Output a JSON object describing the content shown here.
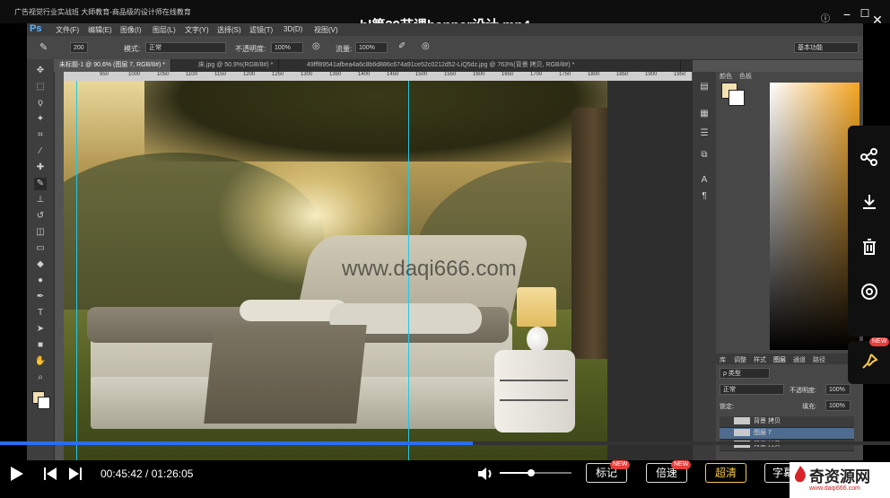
{
  "window": {
    "title": "广告视觉行业实战班 大師教育-商品级的设计师在线教育",
    "video_title": "bl第39节课banner设计.mp4",
    "controls": [
      "ⓘ",
      "−",
      "☐",
      "✕"
    ]
  },
  "photoshop": {
    "logo": "Ps",
    "menu": [
      "文件(F)",
      "编辑(E)",
      "图像(I)",
      "图层(L)",
      "文字(Y)",
      "选择(S)",
      "滤镜(T)",
      "3D(D)",
      "视图(V)"
    ],
    "options": {
      "brush_size": "200",
      "mode_label": "模式:",
      "mode_value": "正常",
      "opacity_label": "不透明度:",
      "opacity_value": "100%",
      "flow_label": "流量:",
      "flow_value": "100%",
      "workspace": "基本功能"
    },
    "tabs": [
      "未标题-1 @ 90.6% (图层 7, RGB/8#) *",
      "床.jpg @ 50.9%(RGB/8#) *",
      "49fff89541afbea4a6c8b6d886c674a91ce52c0212d52-LiQ5dz.jpg @ 763%(背景 拷贝, RGB/8#) *"
    ],
    "ruler_ticks": [
      "950",
      "1000",
      "1050",
      "1100",
      "1150",
      "1200",
      "1250",
      "1300",
      "1350",
      "1400",
      "1450",
      "1500",
      "1550",
      "1600",
      "1650",
      "1700",
      "1750",
      "1800",
      "1850",
      "1900",
      "1950",
      "2000"
    ],
    "canvas_watermark": "www.daqi666.com",
    "panel": {
      "tabs": [
        "颜色",
        "色板"
      ],
      "layer_tabs": [
        "库",
        "调整",
        "样式",
        "图层",
        "通道",
        "路径"
      ],
      "filter": "ρ 类型",
      "blend_mode": "正常",
      "opacity_label": "不透明度:",
      "opacity_value": "100%",
      "lock_label": "锁定:",
      "fill_label": "填充:",
      "fill_value": "100%",
      "layers": [
        "背景 拷贝",
        "图层 7",
        "背景 拷贝"
      ],
      "fg_color": "#f3e0b3",
      "bg_color": "#ffffff"
    }
  },
  "player": {
    "time": "00:45:42 / 01:26:05",
    "progress": 0.531,
    "volume": 0.44,
    "buttons": {
      "mark": "标记",
      "speed": "倍速",
      "quality": "超清",
      "subtitle": "字幕"
    },
    "badge_new": "NEW",
    "watermark_brand": "奇资源网",
    "watermark_url": "www.daqi666.com"
  },
  "colors": {
    "accent_blue": "#2b6df0",
    "quality_gold": "#f5c84c",
    "badge_red": "#e83b3b",
    "guide_cyan": "#21c8e6"
  }
}
